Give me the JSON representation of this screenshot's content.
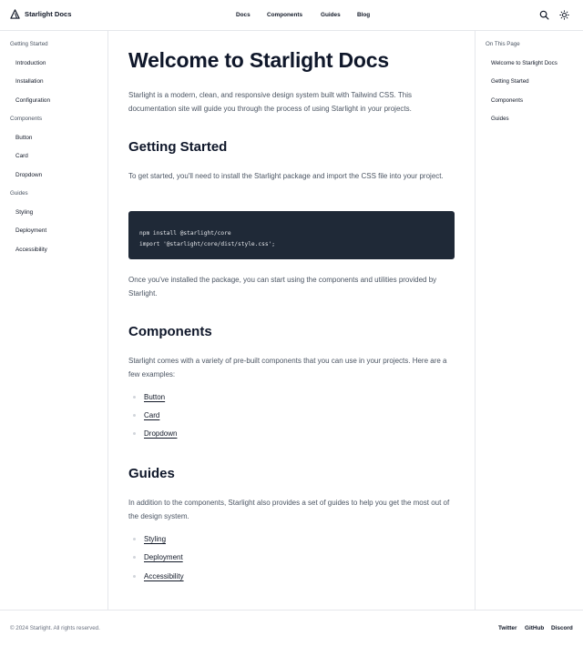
{
  "header": {
    "brand": "Starlight Docs",
    "nav": [
      "Docs",
      "Components",
      "Guides",
      "Blog"
    ],
    "icons": [
      "search-icon",
      "sun-icon"
    ]
  },
  "sidebar": {
    "groups": [
      {
        "title": "Getting Started",
        "items": [
          "Introduction",
          "Installation",
          "Configuration"
        ]
      },
      {
        "title": "Components",
        "items": [
          "Button",
          "Card",
          "Dropdown"
        ]
      },
      {
        "title": "Guides",
        "items": [
          "Styling",
          "Deployment",
          "Accessibility"
        ]
      }
    ]
  },
  "toc": {
    "title": "On This Page",
    "items": [
      "Welcome to Starlight Docs",
      "Getting Started",
      "Components",
      "Guides"
    ]
  },
  "main": {
    "title": "Welcome to Starlight Docs",
    "intro": "Starlight is a modern, clean, and responsive design system built with Tailwind CSS. This documentation site will guide you through the process of using Starlight in your projects.",
    "getting_started": {
      "heading": "Getting Started",
      "text": "To get started, you'll need to install the Starlight package and import the CSS file into your project.",
      "code": [
        "npm install @starlight/core",
        "import '@starlight/core/dist/style.css';"
      ],
      "after": "Once you've installed the package, you can start using the components and utilities provided by Starlight."
    },
    "components": {
      "heading": "Components",
      "text": "Starlight comes with a variety of pre-built components that you can use in your projects. Here are a few examples:",
      "links": [
        "Button",
        "Card",
        "Dropdown"
      ]
    },
    "guides": {
      "heading": "Guides",
      "text": "In addition to the components, Starlight also provides a set of guides to help you get the most out of the design system.",
      "links": [
        "Styling",
        "Deployment",
        "Accessibility"
      ]
    }
  },
  "footer": {
    "copyright": "© 2024 Starlight. All rights reserved.",
    "links": [
      "Twitter",
      "GitHub",
      "Discord"
    ]
  }
}
